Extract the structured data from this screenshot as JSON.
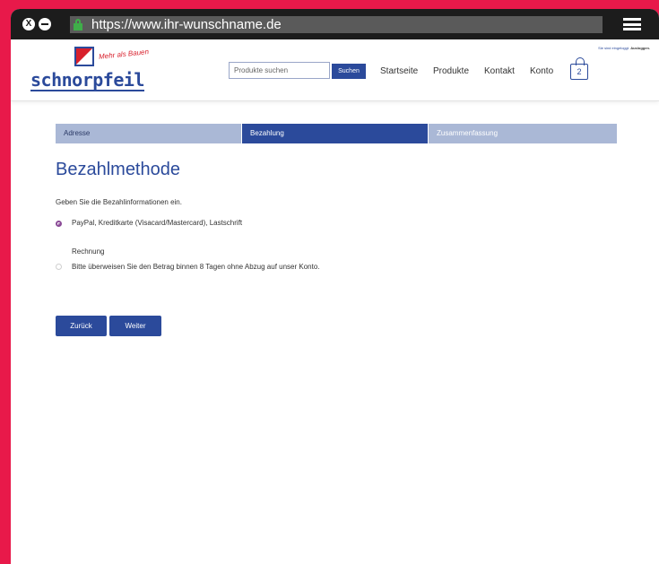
{
  "browser": {
    "url": "https://www.ihr-wunschname.de",
    "close_glyph": "X"
  },
  "logo": {
    "slogan": "Mehr als Bauen",
    "wordmark": "schnorpfeil"
  },
  "search": {
    "placeholder": "Produkte suchen",
    "button_label": "Suchen"
  },
  "nav": {
    "items": [
      "Startseite",
      "Produkte",
      "Kontakt",
      "Konto"
    ]
  },
  "login": {
    "text": "Sie sind eingeloggt.",
    "logout": "Ausloggen."
  },
  "cart": {
    "count": "2"
  },
  "steps": [
    "Adresse",
    "Bezahlung",
    "Zusammenfassung"
  ],
  "page": {
    "title": "Bezahlmethode",
    "intro": "Geben Sie die Bezahlinformationen ein.",
    "option1_label": "PayPal, Kreditkarte (Visacard/Mastercard), Lastschrift",
    "option2_title": "Rechnung",
    "option2_desc": "Bitte überweisen Sie den Betrag binnen 8 Tagen ohne Abzug auf unser Konto."
  },
  "buttons": {
    "back": "Zurück",
    "next": "Weiter"
  }
}
